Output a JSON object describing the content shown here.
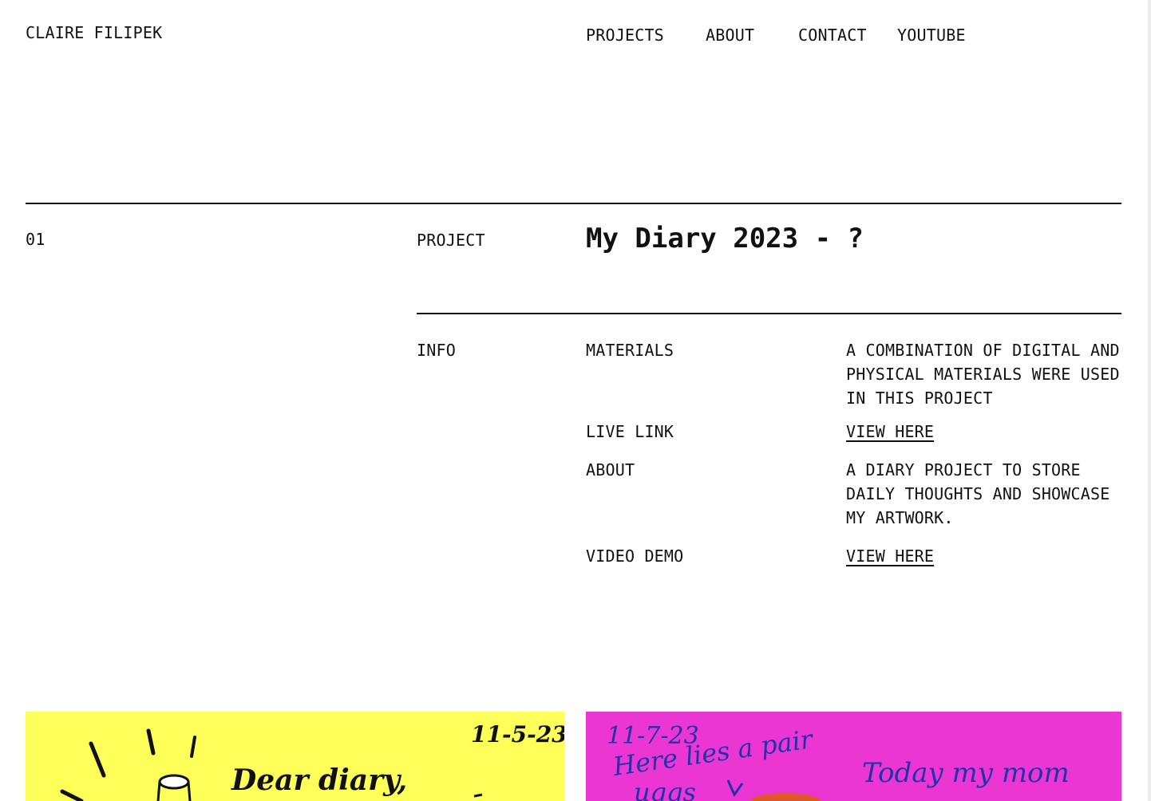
{
  "header": {
    "logo": "CLAIRE FILIPEK",
    "nav": [
      "PROJECTS",
      "ABOUT",
      "CONTACT",
      "YOUTUBE"
    ]
  },
  "project": {
    "number": "01",
    "label": "PROJECT",
    "title": "My Diary 2023 - ?"
  },
  "info": {
    "label": "INFO",
    "rows": [
      {
        "key": "MATERIALS",
        "value": "A COMBINATION OF DIGITAL AND PHYSICAL MATERIALS WERE USED IN THIS PROJECT"
      },
      {
        "key": "LIVE LINK",
        "value": "VIEW HERE"
      },
      {
        "key": "ABOUT",
        "value": "A DIARY PROJECT TO STORE DAILY THOUGHTS AND SHOWCASE MY ARTWORK."
      },
      {
        "key": "VIDEO DEMO",
        "value": "VIEW HERE"
      }
    ]
  },
  "gallery": {
    "left": {
      "bg": "#ffff5a",
      "date": "11-5-23",
      "text": "Dear diary,"
    },
    "right": {
      "bg": "#ec36d3",
      "date": "11-7-23",
      "line1": "Here lies a pair",
      "line2": "uggs",
      "line3": "Today my mom"
    }
  },
  "colors": {
    "ink": "#111111",
    "yellow": "#ffff5a",
    "magenta": "#ec36d3",
    "blue_ink": "#2233aa"
  }
}
